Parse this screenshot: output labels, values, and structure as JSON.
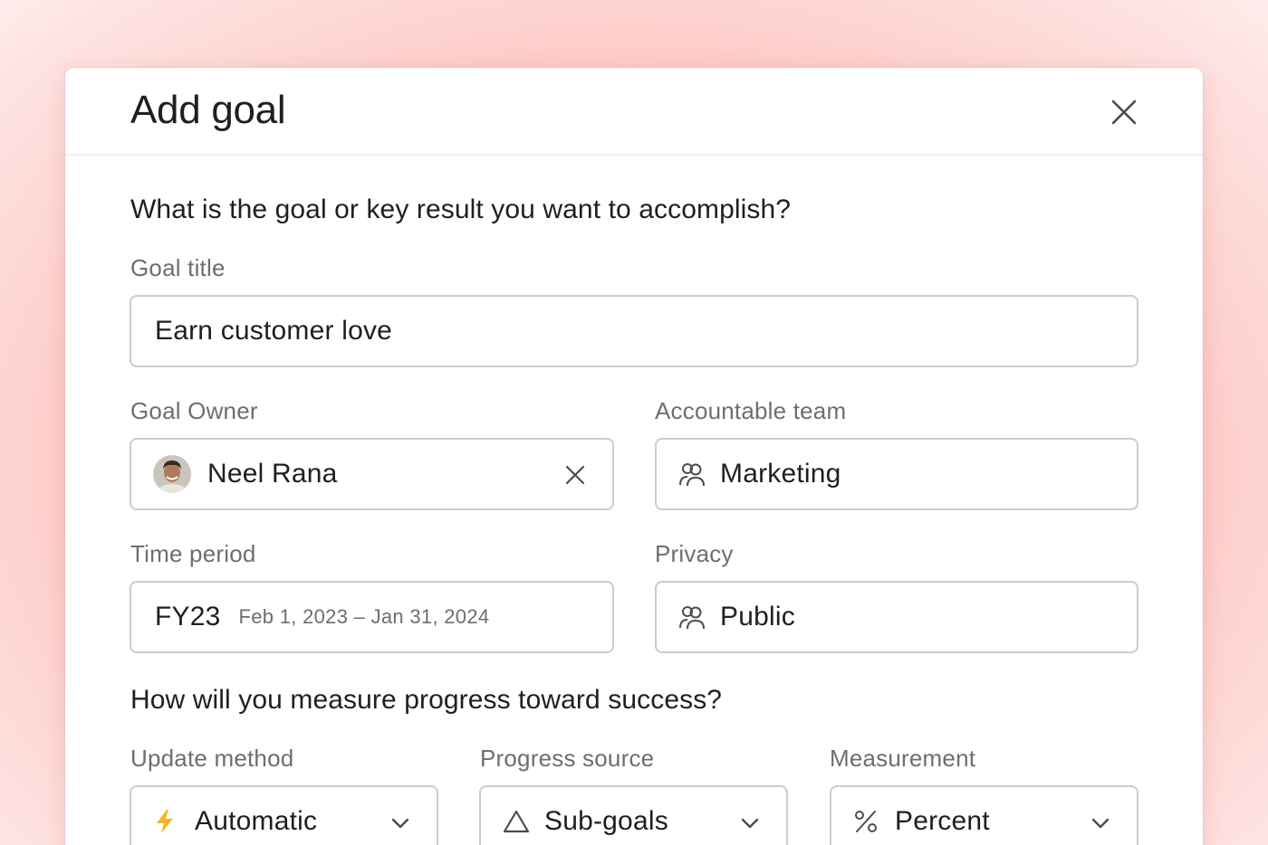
{
  "modal": {
    "title": "Add goal",
    "close_icon": "close-icon"
  },
  "goal_section": {
    "question": "What is the goal or key result you want to accomplish?",
    "goal_title": {
      "label": "Goal title",
      "value": "Earn customer love"
    },
    "goal_owner": {
      "label": "Goal Owner",
      "value": "Neel Rana",
      "avatar_icon": "avatar",
      "clear_icon": "close-icon"
    },
    "accountable_team": {
      "label": "Accountable team",
      "value": "Marketing",
      "icon": "team-icon"
    },
    "time_period": {
      "label": "Time period",
      "value": "FY23",
      "range": "Feb 1, 2023 – Jan 31, 2024"
    },
    "privacy": {
      "label": "Privacy",
      "value": "Public",
      "icon": "team-icon"
    }
  },
  "progress_section": {
    "question": "How will you measure progress toward success?",
    "update_method": {
      "label": "Update method",
      "value": "Automatic",
      "icon": "lightning-icon"
    },
    "progress_source": {
      "label": "Progress source",
      "value": "Sub-goals",
      "icon": "triangle-icon"
    },
    "measurement": {
      "label": "Measurement",
      "value": "Percent",
      "icon": "percent-icon"
    }
  },
  "colors": {
    "background": "#fcb3af",
    "text_primary": "#1e1f21",
    "text_secondary": "#6d6e6f",
    "border": "#cfcbcb",
    "lightning": "#f5b428"
  }
}
